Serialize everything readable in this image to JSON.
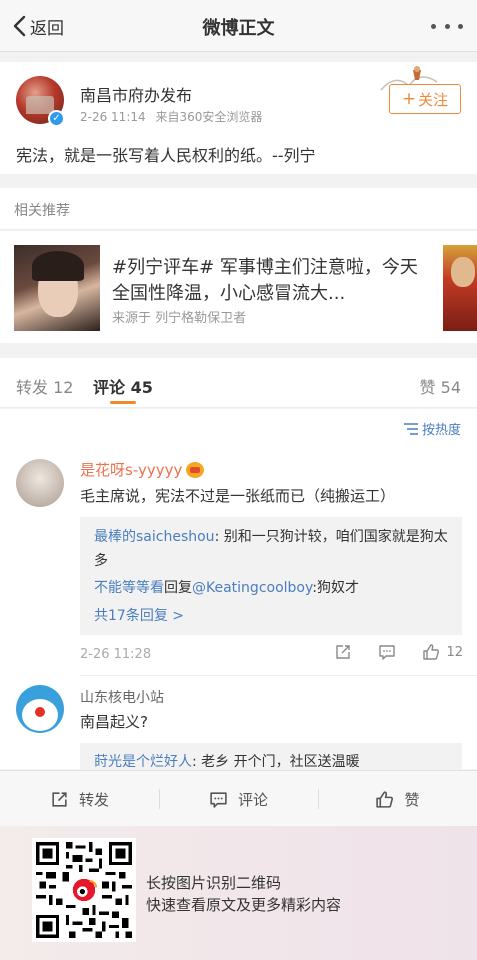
{
  "nav": {
    "back_label": "返回",
    "title": "微博正文"
  },
  "post": {
    "author": "南昌市府办发布",
    "time": "2-26 11:14",
    "source": "来自360安全浏览器",
    "follow_label": "关注",
    "text": "宪法，就是一张写着人民权利的纸。--列宁"
  },
  "related": {
    "label": "相关推荐",
    "headline": "#列宁评车# 军事博主们注意啦，今天全国性降温，小心感冒流大...",
    "source": "来源于 列宁格勒保卫者"
  },
  "tabs": {
    "repost": "转发 12",
    "comment": "评论 45",
    "like": "赞 54"
  },
  "sort_label": "按热度",
  "comments": [
    {
      "name": "是花呀s-yyyyy",
      "text": "毛主席说，宪法不过是一张纸而已（纯搬运工）",
      "replies": [
        {
          "user": "最棒的saicheshou",
          "text": ": 别和一只狗计较，咱们国家就是狗太多"
        },
        {
          "user": "不能等等看",
          "mid": "回复",
          "mention": "@Keatingcoolboy",
          "text": ":狗奴才"
        }
      ],
      "more_replies": "共17条回复 >",
      "time": "2-26 11:28",
      "likes": "12"
    },
    {
      "name": "山东核电小站",
      "text": "南昌起义?",
      "replies": [
        {
          "user": "莳光是个烂好人",
          "text": ": 老乡 开个门，社区送温暖"
        }
      ]
    }
  ],
  "bottom_bar": {
    "repost": "转发",
    "comment": "评论",
    "like": "赞"
  },
  "qr": {
    "line1": "长按图片识别二维码",
    "line2": "快速查看原文及更多精彩内容"
  },
  "colors": {
    "accent_orange": "#f08a3a",
    "link_blue": "#4a7ec0",
    "name_orange": "#eb7350"
  }
}
